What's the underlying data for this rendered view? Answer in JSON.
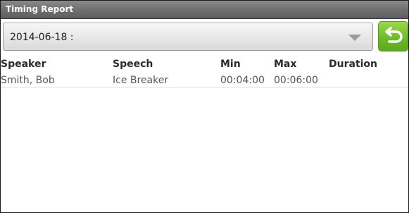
{
  "window": {
    "title": "Timing Report"
  },
  "spinner": {
    "selected": "2014-06-18 :"
  },
  "back_button": {
    "icon": "back-arrow-icon"
  },
  "table": {
    "headers": [
      "Speaker",
      "Speech",
      "Min",
      "Max",
      "Duration"
    ],
    "rows": [
      [
        "Smith, Bob",
        "Ice Breaker",
        "00:04:00",
        "00:06:00",
        ""
      ]
    ]
  },
  "colors": {
    "title_bar": "#6e6e6e",
    "back_button": "#6cba2a"
  }
}
